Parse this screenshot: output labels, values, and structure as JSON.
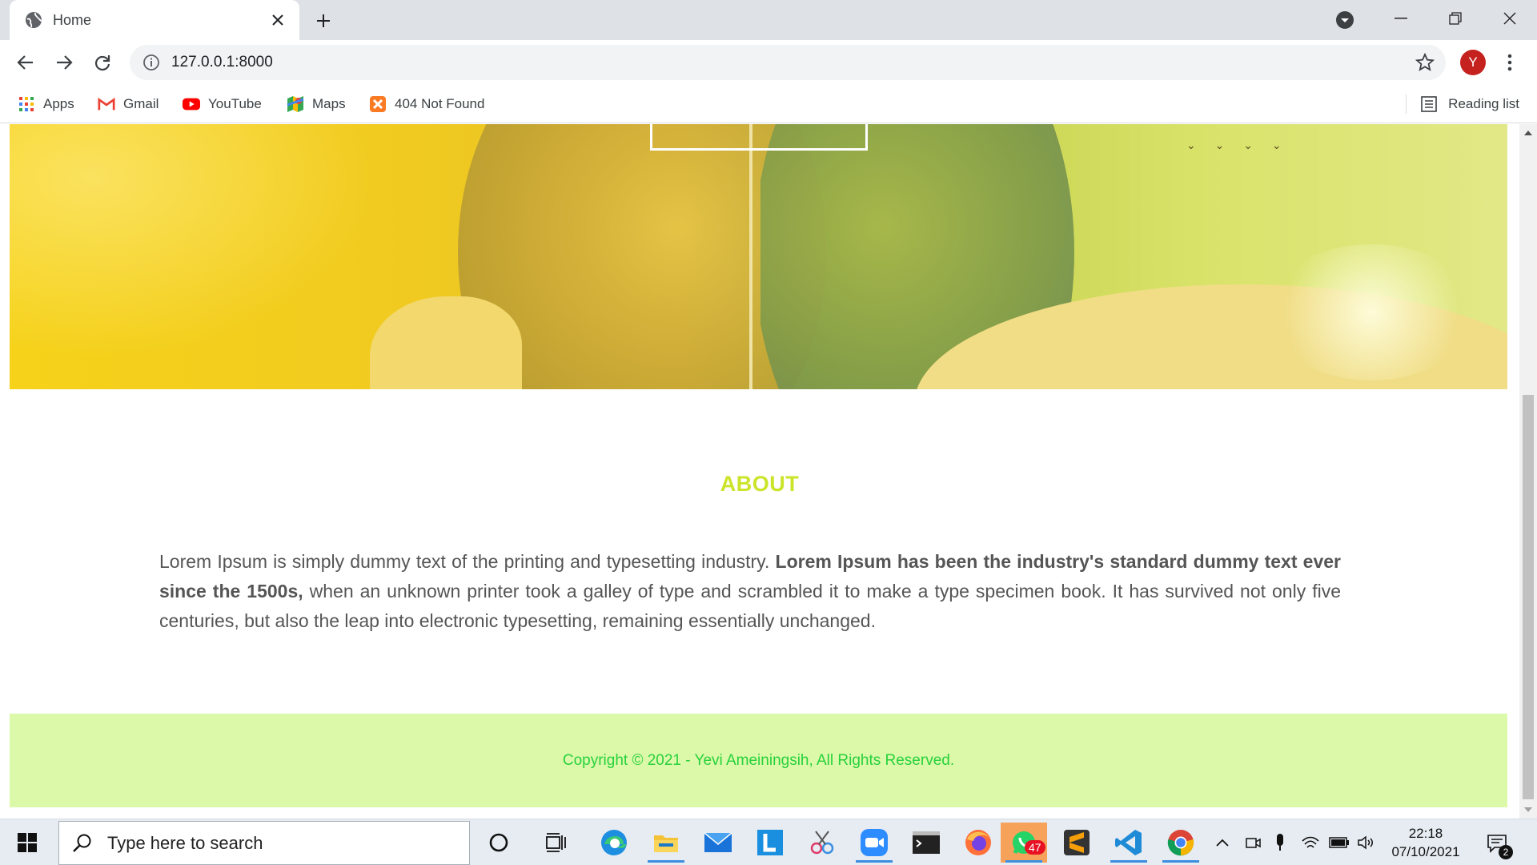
{
  "browser": {
    "tab_title": "Home",
    "url": "127.0.0.1:8000",
    "avatar_letter": "Y",
    "bookmarks": [
      {
        "label": "Apps",
        "icon": "apps-grid-icon"
      },
      {
        "label": "Gmail",
        "icon": "gmail-icon"
      },
      {
        "label": "YouTube",
        "icon": "youtube-icon"
      },
      {
        "label": "Maps",
        "icon": "maps-icon"
      },
      {
        "label": "404 Not Found",
        "icon": "xampp-icon"
      }
    ],
    "reading_list": "Reading list"
  },
  "page": {
    "about_title": "ABOUT",
    "about_text_1": "Lorem Ipsum is simply dummy text of the printing and typesetting industry. ",
    "about_text_bold": "Lorem Ipsum has been the industry's standard dummy text ever since the 1500s,",
    "about_text_2": " when an unknown printer took a galley of type and scrambled it to make a type specimen book. It has survived not only five centuries, but also the leap into electronic typesetting, remaining essentially unchanged.",
    "footer_text": "Copyright © 2021 - Yevi Ameiningsih, All Rights Reserved.",
    "accent_color": "#cbe42a",
    "footer_bg": "#dcf8a9",
    "footer_text_color": "#27d23c"
  },
  "taskbar": {
    "search_placeholder": "Type here to search",
    "time": "22:18",
    "date": "07/10/2021",
    "whatsapp_badge": "47",
    "notification_count": "2"
  }
}
